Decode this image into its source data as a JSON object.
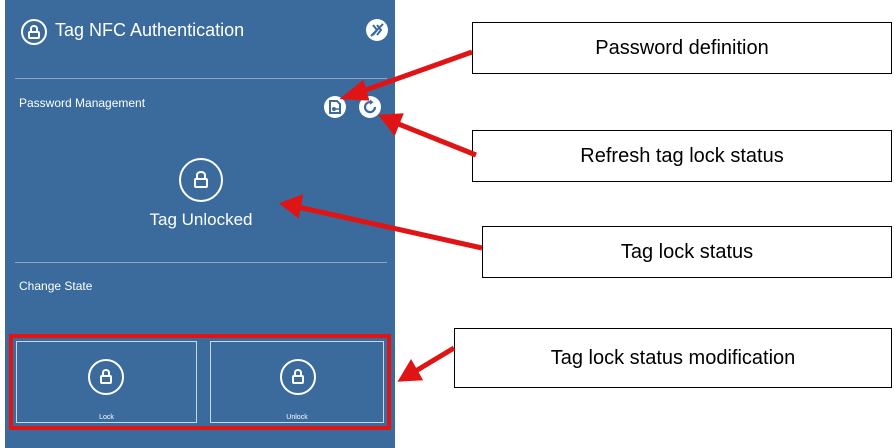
{
  "app": {
    "title": "Tag NFC Authentication",
    "header_icon": "lock-icon",
    "header_action_icon": "nfc-off-icon"
  },
  "password_management": {
    "label": "Password Management",
    "password_button_icon": "password-definition-icon",
    "refresh_button_icon": "refresh-icon"
  },
  "status": {
    "icon": "lock-icon",
    "text": "Tag Unlocked"
  },
  "change_state": {
    "label": "Change State",
    "buttons": [
      {
        "label": "Lock",
        "icon": "lock-icon"
      },
      {
        "label": "Unlock",
        "icon": "lock-icon"
      }
    ]
  },
  "callouts": {
    "password_definition": "Password definition",
    "refresh_status": "Refresh tag lock status",
    "lock_status": "Tag lock status",
    "modification": "Tag lock status modification"
  },
  "colors": {
    "panel_bg": "#3a6b9c",
    "highlight": "#e01414",
    "arrow": "#e01414",
    "text_light": "#ffffff"
  }
}
